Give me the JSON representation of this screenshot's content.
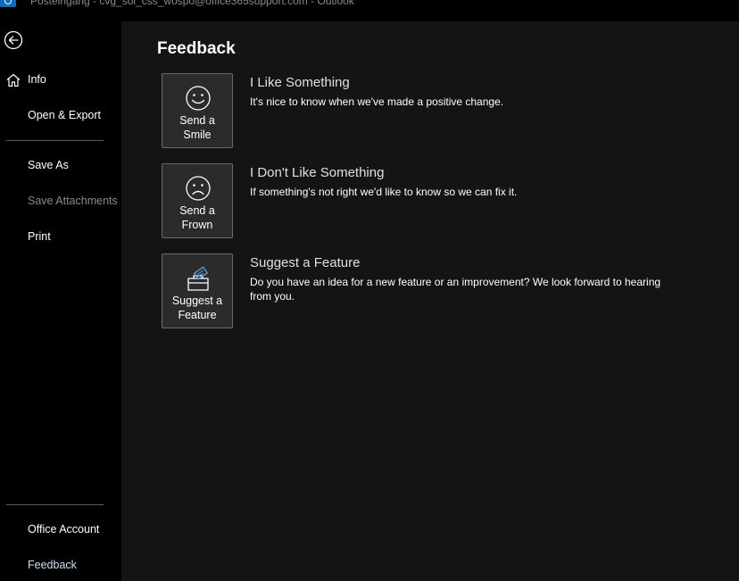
{
  "window": {
    "title": "Posteingang - cvg_sol_css_wospo@office365support.com  -  Outlook"
  },
  "sidebar": {
    "items": [
      {
        "label": "Info"
      },
      {
        "label": "Open & Export"
      },
      {
        "label": "Save As"
      },
      {
        "label": "Save Attachments"
      },
      {
        "label": "Print"
      },
      {
        "label": "Office Account"
      },
      {
        "label": "Feedback"
      }
    ]
  },
  "main": {
    "title": "Feedback",
    "options": [
      {
        "button_label_line1": "Send a",
        "button_label_line2": "Smile",
        "heading": "I Like Something",
        "description": "It's nice to know when we've made a positive change."
      },
      {
        "button_label_line1": "Send a",
        "button_label_line2": "Frown",
        "heading": "I Don't Like Something",
        "description": "If something's not right we'd like to know so we can fix it."
      },
      {
        "button_label_line1": "Suggest a",
        "button_label_line2": "Feature",
        "heading": "Suggest a Feature",
        "description": "Do you have an idea for a new feature or an improvement? We look forward to hearing from you."
      }
    ]
  },
  "icons": {
    "back": "back-arrow-icon",
    "home": "home-icon",
    "smile": "smile-icon",
    "frown": "frown-icon",
    "suggestion": "suggestion-box-icon"
  },
  "colors": {
    "sidebar_bg": "#000000",
    "main_bg": "#141414",
    "card_bg": "#2b2b2b",
    "card_border": "#6a6a6a",
    "disabled_text": "#8a8a8a",
    "active_text": "#c7e0f4",
    "app_icon": "#0f6cbd"
  }
}
